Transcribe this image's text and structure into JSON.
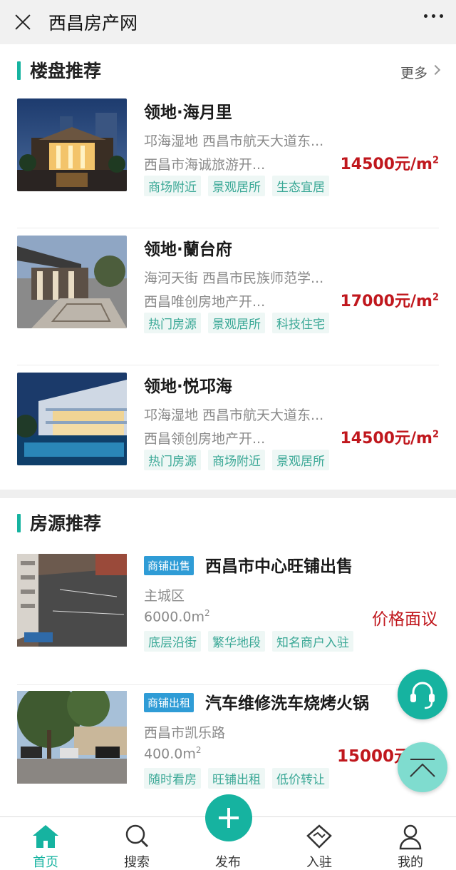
{
  "header": {
    "title": "西昌房产网"
  },
  "estates": {
    "title": "楼盘推荐",
    "more": "更多",
    "items": [
      {
        "name": "领地·海月里",
        "address": "邛海湿地 西昌市航天大道东...",
        "developer": "西昌市海诚旅游开...",
        "price": "14500元/m",
        "price_sup": "2",
        "tags": [
          "商场附近",
          "景观居所",
          "生态宜居"
        ]
      },
      {
        "name": "领地·蘭台府",
        "address": "海河天街 西昌市民族师范学...",
        "developer": "西昌唯创房地产开...",
        "price": "17000元/m",
        "price_sup": "2",
        "tags": [
          "热门房源",
          "景观居所",
          "科技住宅"
        ]
      },
      {
        "name": "领地·悦邛海",
        "address": "邛海湿地 西昌市航天大道东...",
        "developer": "西昌领创房地产开...",
        "price": "14500元/m",
        "price_sup": "2",
        "tags": [
          "热门房源",
          "商场附近",
          "景观居所"
        ]
      }
    ]
  },
  "listings": {
    "title": "房源推荐",
    "items": [
      {
        "badge": "商铺出售",
        "title": "西昌市中心旺铺出售",
        "district": "主城区",
        "area": "6000.0m",
        "area_sup": "2",
        "price": "价格面议",
        "tags": [
          "底层沿街",
          "繁华地段",
          "知名商户入驻"
        ]
      },
      {
        "badge": "商铺出租",
        "title": "汽车维修洗车烧烤火锅",
        "district": "西昌市凯乐路",
        "area": "400.0m",
        "area_sup": "2",
        "price": "15000元",
        "tags": [
          "随时看房",
          "旺铺出租",
          "低价转让"
        ]
      }
    ]
  },
  "nav": {
    "home": "首页",
    "search": "搜索",
    "publish": "发布",
    "join": "入驻",
    "mine": "我的"
  },
  "colors": {
    "accent": "#16b3a0",
    "price": "#c0171d",
    "badge": "#2f9cd6"
  }
}
